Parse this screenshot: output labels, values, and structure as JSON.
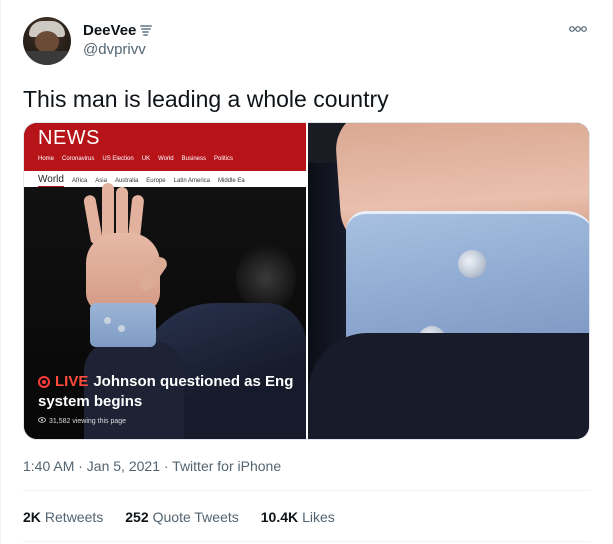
{
  "tweet": {
    "author_name": "DeeVee",
    "author_badge_icon": "tornado-icon",
    "handle": "@dvprivv",
    "more_icon": "more-options-icon",
    "text": "This man is leading a whole country",
    "timestamp": "1:40 AM · Jan 5, 2021 · Twitter for iPhone"
  },
  "media": {
    "news_logo": "NEWS",
    "nav_items": [
      "Home",
      "Coronavirus",
      "US Election",
      "UK",
      "World",
      "Business",
      "Politics"
    ],
    "sub_nav_items": [
      "World",
      "Africa",
      "Asia",
      "Australia",
      "Europe",
      "Latin America",
      "Middle Ea"
    ],
    "live_label": "LIVE",
    "headline_line1": "Johnson questioned as Eng",
    "headline_line2": "system begins",
    "viewers": "31,582 viewing this page"
  },
  "stats": [
    {
      "num": "2K",
      "label": "Retweets"
    },
    {
      "num": "252",
      "label": "Quote Tweets"
    },
    {
      "num": "10.4K",
      "label": "Likes"
    }
  ]
}
